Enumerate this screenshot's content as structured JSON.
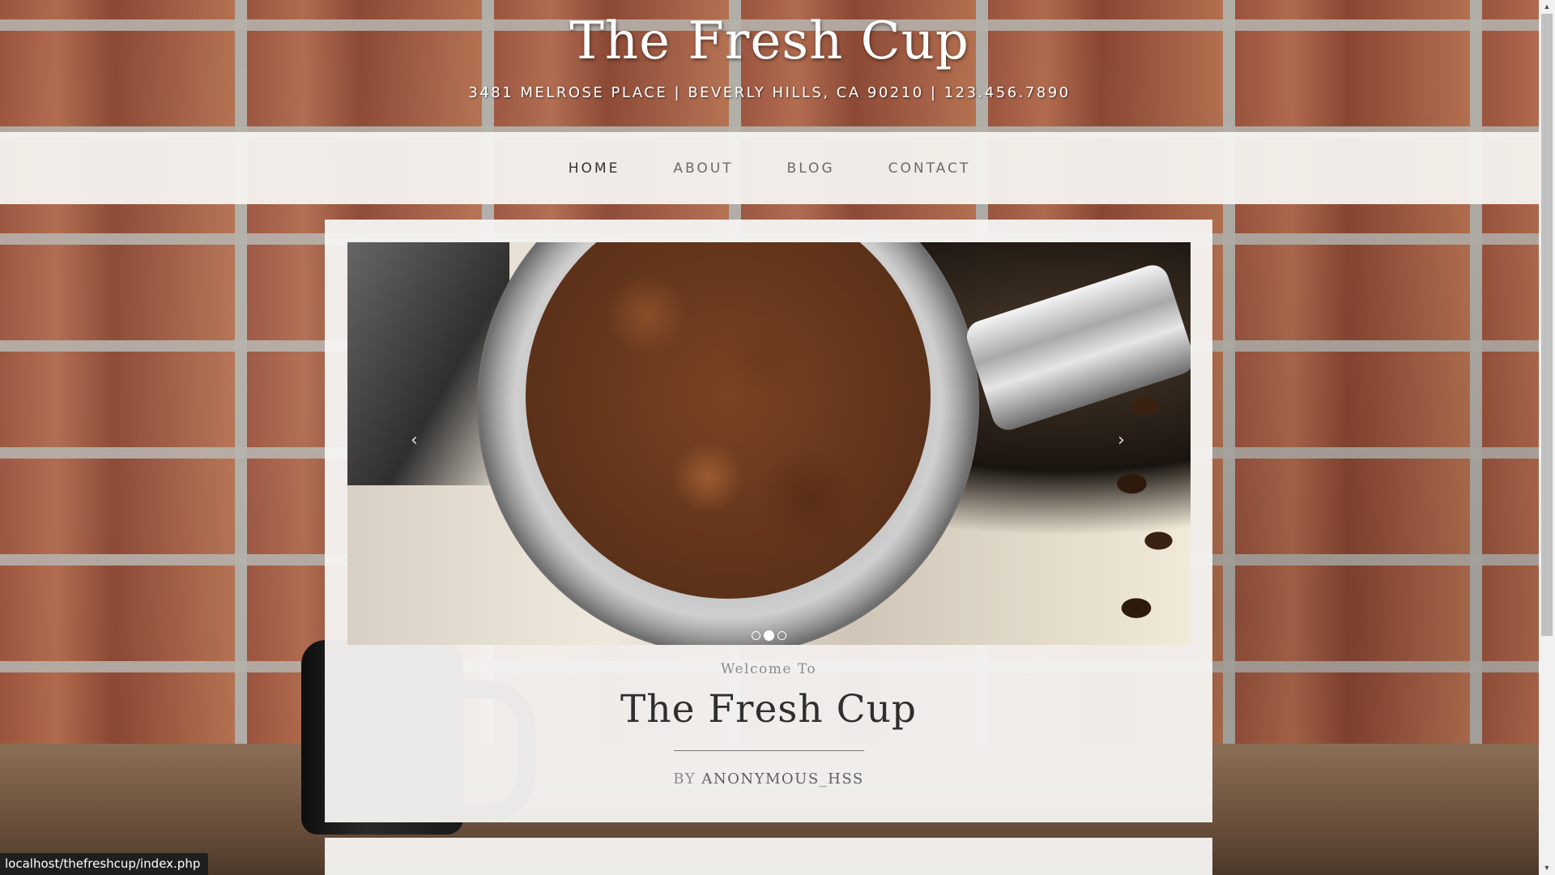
{
  "header": {
    "title": "The Fresh Cup",
    "address": "3481 MELROSE PLACE | BEVERLY HILLS, CA 90210 | 123.456.7890"
  },
  "nav": {
    "items": [
      {
        "label": "HOME",
        "active": true
      },
      {
        "label": "ABOUT",
        "active": false
      },
      {
        "label": "BLOG",
        "active": false
      },
      {
        "label": "CONTACT",
        "active": false
      }
    ]
  },
  "slider": {
    "prev_icon": "‹",
    "next_icon": "›",
    "slide_count": 3,
    "active_slide_index": 1
  },
  "post": {
    "welcome_label": "Welcome To",
    "title": "The Fresh Cup",
    "byline_prefix": "BY",
    "byline_author": "ANONYMOUS_HSS"
  },
  "status_bar": {
    "url": "localhost/thefreshcup/index.php"
  },
  "scrollbar": {
    "up_icon": "▲",
    "down_icon": "▼"
  },
  "colors": {
    "nav_bg": "#f5f3f0",
    "card_bg": "#f6f4f2",
    "brick_accent": "#9a533d",
    "title_text": "#2f2f2f"
  }
}
